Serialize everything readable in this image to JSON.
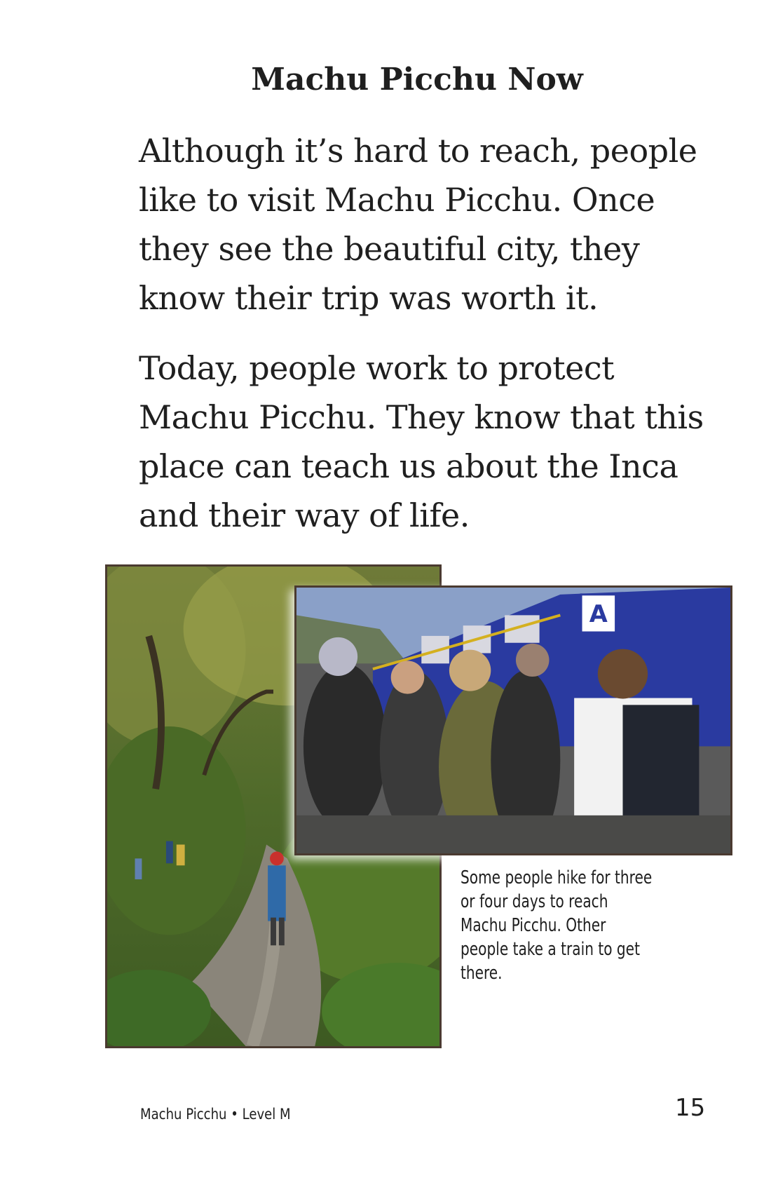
{
  "page": {
    "title": "Machu Picchu Now",
    "paragraphs": [
      "Although it’s hard to reach, people like to visit Machu Picchu. Once they see the beautiful city, they know their trip was worth it.",
      "Today, people work to protect Machu Picchu. They know that this place can teach us about the Inca and their way of life."
    ],
    "caption": "Some people hike for three or four days to reach Machu Picchu. Other people take a train to get there.",
    "footer": "Machu Picchu • Level M",
    "page_number": "15"
  },
  "photos": {
    "trail_icon": "hiking-trail-photo",
    "train_icon": "train-station-photo",
    "train_sign": "A"
  }
}
